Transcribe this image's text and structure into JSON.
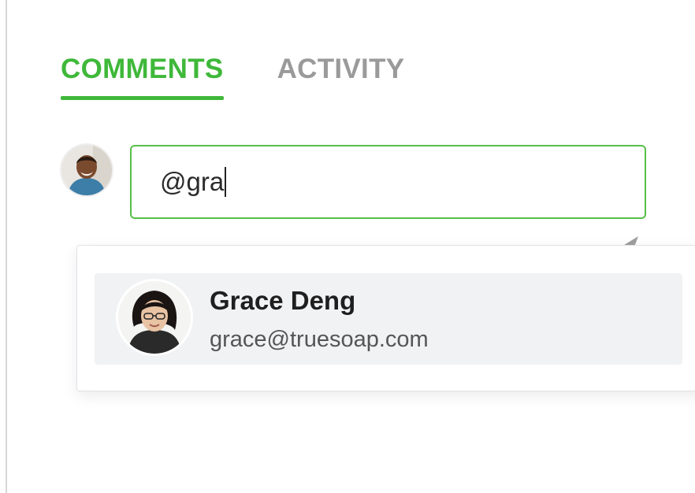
{
  "tabs": [
    {
      "label": "COMMENTS",
      "active": true
    },
    {
      "label": "ACTIVITY",
      "active": false
    }
  ],
  "comment_input": {
    "value": "@gra"
  },
  "mention_suggestions": [
    {
      "name": "Grace Deng",
      "email": "grace@truesoap.com"
    }
  ],
  "colors": {
    "accent": "#3fb83a",
    "inactive_tab": "#9a9a9a",
    "suggestion_highlight": "#f1f2f4"
  },
  "icons": {
    "send": "send-icon"
  }
}
